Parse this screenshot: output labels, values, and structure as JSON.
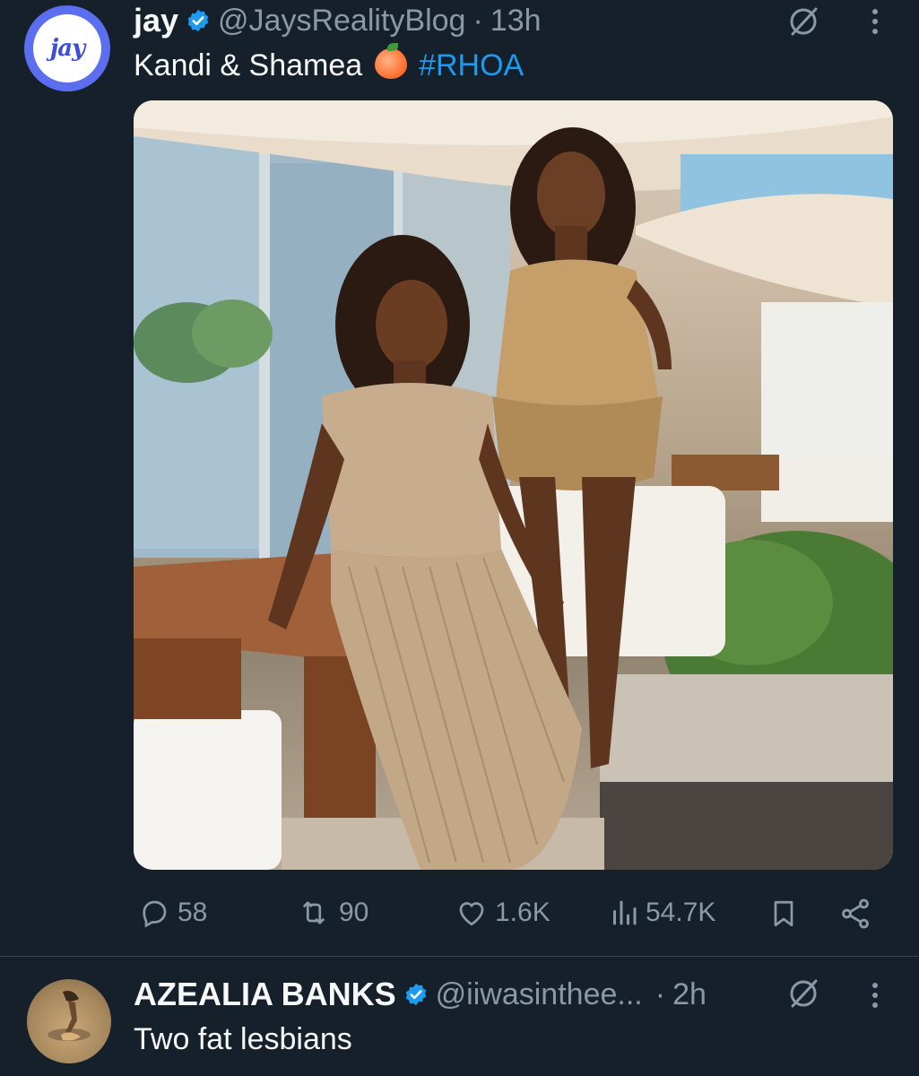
{
  "tweet1": {
    "author_name": "jay",
    "avatar_text": "jay",
    "handle": "@JaysRealityBlog",
    "separator": "·",
    "time": "13h",
    "text": "Kandi & Shamea",
    "emoji": "peach-emoji",
    "hashtag": "#RHOA",
    "stats": {
      "replies": "58",
      "reposts": "90",
      "likes": "1.6K",
      "views": "54.7K"
    }
  },
  "tweet2": {
    "author_name": "AZEALIA BANKS",
    "handle": "@iiwasinthee...",
    "separator": "·",
    "time": "2h",
    "text": "Two fat lesbians"
  },
  "colors": {
    "background": "#15202b",
    "accent": "#1d9bf0",
    "secondary_text": "#8b98a5"
  }
}
